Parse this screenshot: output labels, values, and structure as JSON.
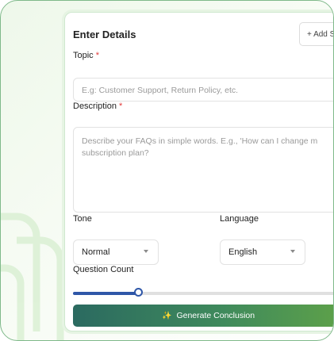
{
  "card": {
    "title": "Enter Details",
    "add_button_label": "+ Add S"
  },
  "topic": {
    "label": "Topic",
    "required_marker": "*",
    "placeholder": "E.g: Customer Support, Return Policy, etc."
  },
  "description": {
    "label": "Description",
    "required_marker": "*",
    "placeholder": "Describe your FAQs in simple words. E.g., 'How can I change m subscription plan?"
  },
  "tone": {
    "label": "Tone",
    "selected": "Normal"
  },
  "language": {
    "label": "Language",
    "selected": "English"
  },
  "question_count": {
    "label": "Question Count",
    "fraction": 0.24
  },
  "generate_button": {
    "label": "Generate Conclusion",
    "icon": "magic-wand-icon"
  },
  "colors": {
    "accent_slider": "#2f57a8",
    "required": "#e23b3b",
    "button_gradient_start": "#2b6a60",
    "button_gradient_end": "#5fa248"
  }
}
